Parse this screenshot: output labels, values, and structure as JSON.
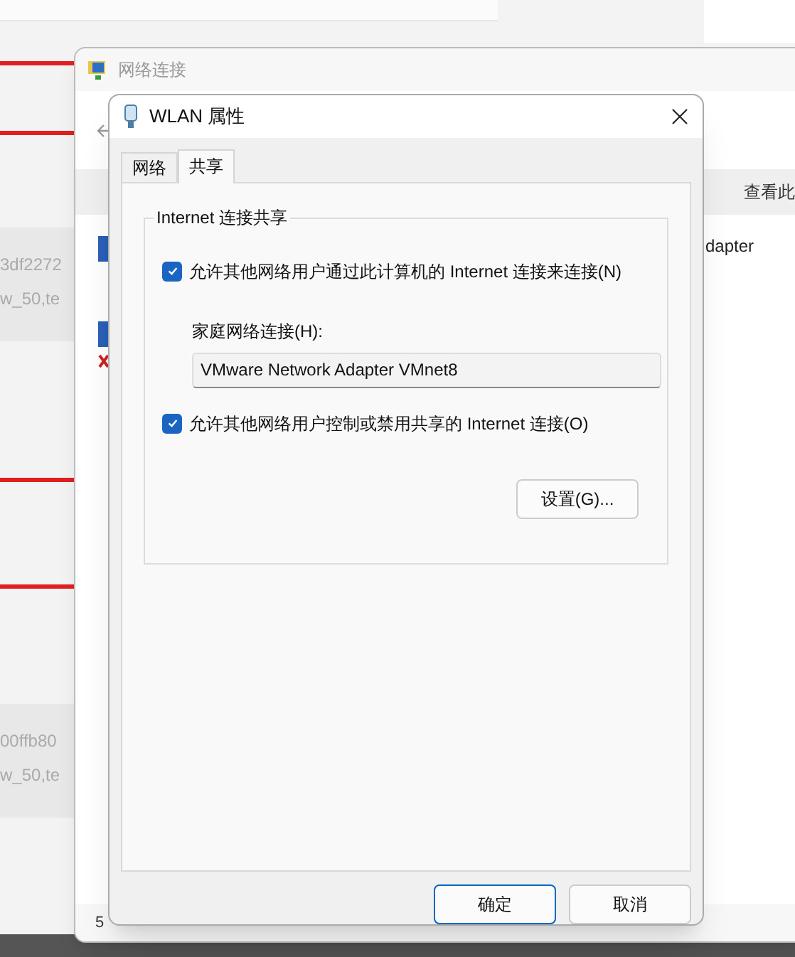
{
  "background": {
    "left_rows": [
      {
        "line_1": "3df2272",
        "line_2": "w_50,te"
      },
      {
        "line_1": "00ffb80",
        "line_2": "w_50,te"
      }
    ]
  },
  "back_window": {
    "title": "网络连接",
    "toolbar_link": "查看此",
    "adapter_text": "dapter",
    "status_count": "5"
  },
  "dialog": {
    "title": "WLAN 属性",
    "tabs": [
      {
        "label": "网络",
        "selected": false
      },
      {
        "label": "共享",
        "selected": true
      }
    ],
    "group": {
      "legend": "Internet 连接共享",
      "allow_sharing": {
        "label": "允许其他网络用户通过此计算机的 Internet 连接来连接(N)",
        "checked": true
      },
      "home_network_label": "家庭网络连接(H):",
      "home_network_value": "VMware Network Adapter VMnet8",
      "allow_control": {
        "label": "允许其他网络用户控制或禁用共享的 Internet 连接(O)",
        "checked": true
      },
      "settings_button": "设置(G)..."
    },
    "buttons": [
      {
        "label": "确定",
        "default": true
      },
      {
        "label": "取消",
        "default": false
      }
    ]
  }
}
